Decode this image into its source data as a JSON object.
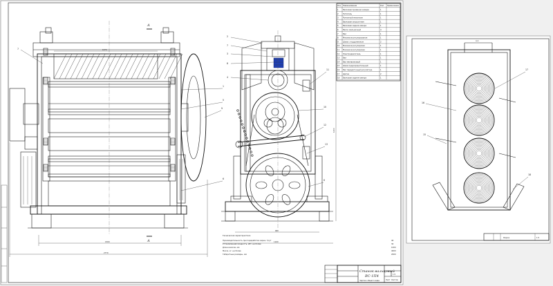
{
  "parts_table": {
    "headers": [
      "Поз.",
      "Наименование",
      "Кол.",
      "Примечание"
    ],
    "rows": [
      [
        "1",
        "Валковая приемная камера",
        "1",
        ""
      ],
      [
        "2",
        "Питатель",
        "1",
        ""
      ],
      [
        "3",
        "Рычажный механизм",
        "1",
        ""
      ],
      [
        "4",
        "Валковая загрузочная",
        "1",
        ""
      ],
      [
        "5",
        "Валковая задняя камера",
        "1",
        ""
      ],
      [
        "6",
        "Валок мельничный",
        "4",
        ""
      ],
      [
        "7",
        "Вал",
        "1",
        ""
      ],
      [
        "8",
        "Механизм регулирования",
        "1",
        ""
      ],
      [
        "9",
        "Шкив с подшипником",
        "2",
        ""
      ],
      [
        "10",
        "Механизм регулировки",
        "1",
        ""
      ],
      [
        "11",
        "Механизм регулировки",
        "1",
        ""
      ],
      [
        "12",
        "Электродвигатель",
        "1",
        ""
      ],
      [
        "13",
        "Вал",
        "1",
        ""
      ],
      [
        "14",
        "Вал межвалковый",
        "1",
        ""
      ],
      [
        "15",
        "Шкив предохранительный",
        "1",
        ""
      ],
      [
        "16",
        "Вал передаточный регулятора",
        "1",
        ""
      ],
      [
        "17",
        "Щетка",
        "2",
        ""
      ],
      [
        "18",
        "Валковая задняя камера",
        "1",
        ""
      ]
    ]
  },
  "tech_specs": {
    "title": "Техническая характеристика",
    "lines": [
      "Производительность при переработке зерна, т/сут",
      "Установленная мощность, кВт, не более",
      "Длина валков, мм",
      "Масса, кг, не более",
      "Габаритные размеры, мм"
    ],
    "values": [
      "40",
      "30",
      "1000",
      "4000",
      "2000"
    ]
  },
  "title_block": {
    "name_line1": "Станок вальцовый",
    "name_line2": "ВС-1П4",
    "sheet_label": "Лист",
    "sheets_label": "Листов",
    "scale": "1:5",
    "doc": "Чертеж общего вида"
  },
  "sheet2_block": {
    "label": "Разрез",
    "scale": "1:5"
  },
  "front_view": {
    "labels": [
      "7",
      "1",
      "5",
      "9",
      "6"
    ],
    "dims": [
      "1970",
      "1500",
      "2770"
    ],
    "section_mark": "А"
  },
  "side_view": {
    "labels": [
      "2",
      "7",
      "3",
      "8",
      "4",
      "11",
      "10",
      "12",
      "13",
      "6"
    ],
    "dims": [
      "680",
      "1160",
      "1200"
    ]
  },
  "section_view": {
    "labels": [
      "A-A",
      "17",
      "16",
      "15",
      "18"
    ]
  }
}
